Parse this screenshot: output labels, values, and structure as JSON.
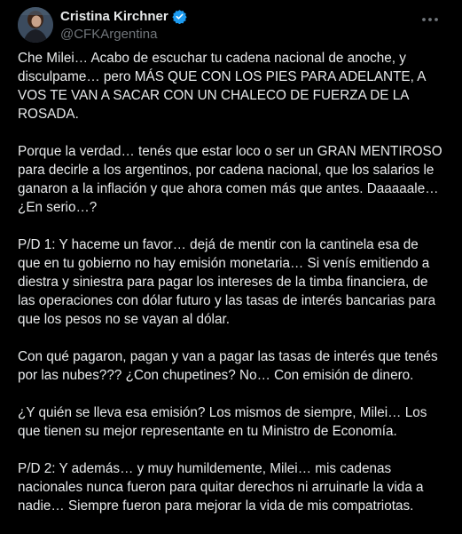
{
  "author": {
    "name": "Cristina Kirchner",
    "handle": "@CFKArgentina"
  },
  "icons": {
    "verified": "verified-badge-icon",
    "more": "more-options-icon",
    "verified_color": "#1d9bf0"
  },
  "paragraphs": [
    "Che Milei… Acabo de escuchar tu cadena nacional de anoche, y disculpame… pero MÁS QUE CON LOS PIES PARA ADELANTE, A VOS TE VAN A SACAR CON UN CHALECO DE FUERZA DE LA ROSADA.",
    "Porque la verdad… tenés que estar loco o ser un GRAN MENTIROSO para decirle a los argentinos, por cadena nacional, que los salarios le ganaron a la inflación y que ahora comen más que antes. Daaaaale… ¿En serio…?",
    "P/D 1: Y haceme un favor… dejá de mentir con la cantinela esa de que en tu gobierno no hay emisión monetaria… Si venís emitiendo a diestra y siniestra para pagar los intereses de la timba financiera, de las operaciones con dólar futuro y las tasas de interés bancarias para que los pesos no se vayan al dólar.",
    "Con qué pagaron, pagan y van a pagar las tasas de interés que tenés por las nubes??? ¿Con chupetines? No… Con emisión de dinero.",
    "¿Y quién se lleva esa emisión? Los mismos de siempre, Milei… Los que tienen su mejor representante en tu Ministro de Economía.",
    "P/D 2: Y además… y muy humildemente, Milei… mis cadenas nacionales nunca fueron para quitar derechos ni arruinarle la vida a nadie… Siempre fueron para mejorar la vida de mis compatriotas."
  ]
}
